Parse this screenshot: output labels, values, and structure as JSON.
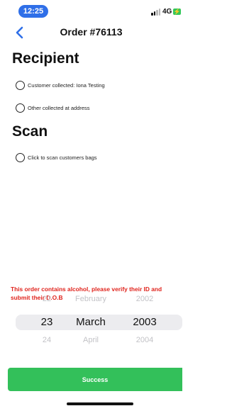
{
  "status_bar": {
    "time": "12:25",
    "network": "4G"
  },
  "nav": {
    "title": "Order #76113"
  },
  "recipient": {
    "heading": "Recipient",
    "options": [
      {
        "label": "Customer collected: Iona Testing",
        "selected": false
      },
      {
        "label": "Other collected at address",
        "selected": false
      }
    ]
  },
  "scan": {
    "heading": "Scan",
    "option_label": "Click to scan customers bags"
  },
  "alert": {
    "message": "This order contains alcohol, please verify their ID and submit their D.O.B",
    "color": "#e0241d"
  },
  "dob_picker": {
    "prev": {
      "day": "22",
      "month": "February",
      "year": "2002"
    },
    "current": {
      "day": "23",
      "month": "March",
      "year": "2003"
    },
    "next": {
      "day": "24",
      "month": "April",
      "year": "2004"
    }
  },
  "footer": {
    "success_label": "Success",
    "success_color": "#33c05a"
  },
  "colors": {
    "accent": "#2f6fe8",
    "battery": "#34c759"
  }
}
